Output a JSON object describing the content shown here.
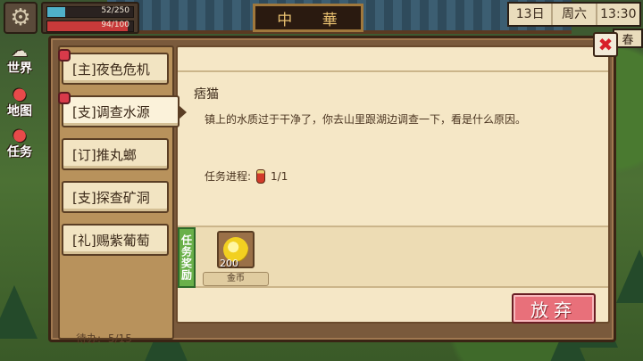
{
  "hud": {
    "gear_icon": "gear-icon",
    "hp_text": "52/250",
    "hp_value": 52,
    "hp_max": 250,
    "mp_text": "94/100",
    "mp_value": 94,
    "mp_max": 100,
    "side_buttons": [
      {
        "label": "世界",
        "icon": "world-icon",
        "icon_glyph": "☁"
      },
      {
        "label": "地图",
        "icon": "map-pin-icon",
        "icon_glyph": "●"
      },
      {
        "label": "任务",
        "icon": "task-pin-icon",
        "icon_glyph": "●"
      }
    ],
    "date": "13日",
    "weekday": "周六",
    "time": "13:30",
    "season": "春"
  },
  "world": {
    "gate_sign": "中 華"
  },
  "quest_dialog": {
    "quests": [
      {
        "label": "[主]夜色危机",
        "has_alert": true,
        "active": false
      },
      {
        "label": "[支]调查水源",
        "has_alert": true,
        "active": true
      },
      {
        "label": "[订]推丸螂",
        "has_alert": false,
        "active": false
      },
      {
        "label": "[支]探查矿洞",
        "has_alert": false,
        "active": false
      },
      {
        "label": "[礼]赐紫葡萄",
        "has_alert": false,
        "active": false
      }
    ],
    "pending_label": "待办:",
    "pending_count": "5/15",
    "detail": {
      "giver": "痞猫",
      "description": "镇上的水质过于干净了，你去山里跟湖边调查一下，看是什么原因。",
      "progress_label": "任务进程:",
      "progress_icon": "potion-icon",
      "progress_value": "1/1"
    },
    "reward": {
      "tag": "任务奖励",
      "item_icon": "gold-coin-icon",
      "quantity": "200",
      "name": "金币"
    },
    "abandon_label": "放弃",
    "close_icon": "close-icon",
    "close_glyph": "✖"
  },
  "colors": {
    "alert_red": "#d83a4a",
    "reward_green": "#6ab04a",
    "abandon_pink": "#e8707a",
    "hp_bar": "#4fb0c8",
    "mp_bar": "#c83a3a"
  }
}
